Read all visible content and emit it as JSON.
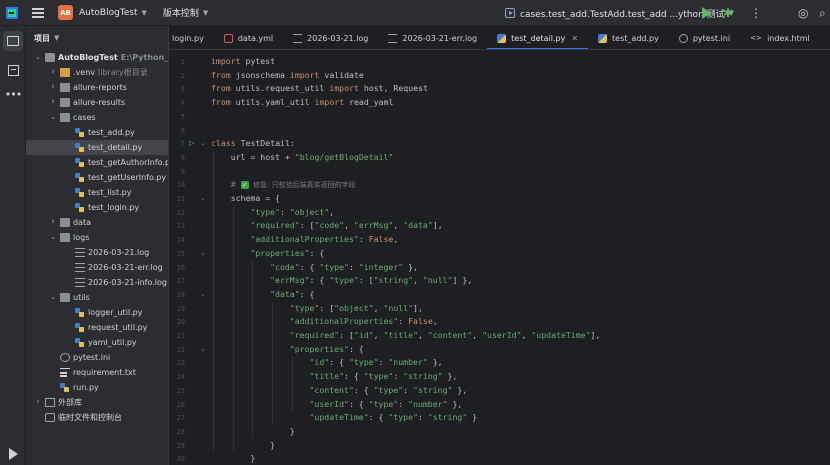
{
  "titlebar": {
    "project_badge": "AB",
    "project_name": "AutoBlogTest",
    "vcs_label": "版本控制",
    "run_config": "cases.test_add.TestAdd.test_add ...ython 测试"
  },
  "project_panel": {
    "title": "项目",
    "tree": [
      {
        "label": "AutoBlogTest",
        "sub": "E:\\Python_Auto",
        "indent": 0,
        "arrow": "down",
        "icon": "folder",
        "bold": true
      },
      {
        "label": ".venv",
        "sub": "library根目录",
        "indent": 1,
        "arrow": "right",
        "icon": "folder-excluded"
      },
      {
        "label": "allure-reports",
        "indent": 1,
        "arrow": "right",
        "icon": "folder"
      },
      {
        "label": "allure-results",
        "indent": 1,
        "arrow": "right",
        "icon": "folder"
      },
      {
        "label": "cases",
        "indent": 1,
        "arrow": "down",
        "icon": "folder"
      },
      {
        "label": "test_add.py",
        "indent": 2,
        "icon": "python"
      },
      {
        "label": "test_detail.py",
        "indent": 2,
        "icon": "python",
        "selected": true
      },
      {
        "label": "test_getAuthorInfo.py",
        "indent": 2,
        "icon": "python"
      },
      {
        "label": "test_getUserInfo.py",
        "indent": 2,
        "icon": "python"
      },
      {
        "label": "test_list.py",
        "indent": 2,
        "icon": "python"
      },
      {
        "label": "test_login.py",
        "indent": 2,
        "icon": "python"
      },
      {
        "label": "data",
        "indent": 1,
        "arrow": "right",
        "icon": "folder"
      },
      {
        "label": "logs",
        "indent": 1,
        "arrow": "down",
        "icon": "folder"
      },
      {
        "label": "2026-03-21.log",
        "indent": 2,
        "icon": "log"
      },
      {
        "label": "2026-03-21-err.log",
        "indent": 2,
        "icon": "log"
      },
      {
        "label": "2026-03-21-info.log",
        "indent": 2,
        "icon": "log"
      },
      {
        "label": "utils",
        "indent": 1,
        "arrow": "down",
        "icon": "folder"
      },
      {
        "label": "logger_util.py",
        "indent": 2,
        "icon": "python"
      },
      {
        "label": "request_util.py",
        "indent": 2,
        "icon": "python"
      },
      {
        "label": "yaml_util.py",
        "indent": 2,
        "icon": "python"
      },
      {
        "label": "pytest.ini",
        "indent": 1,
        "icon": "ini"
      },
      {
        "label": "requirement.txt",
        "indent": 1,
        "icon": "txt"
      },
      {
        "label": "run.py",
        "indent": 1,
        "icon": "python"
      },
      {
        "label": "外部库",
        "indent": 0,
        "arrow": "right",
        "icon": "library"
      },
      {
        "label": "临时文件和控制台",
        "indent": 0,
        "icon": "scratch"
      }
    ]
  },
  "tabs": [
    {
      "label": "login.py",
      "icon": "python"
    },
    {
      "label": "data.yml",
      "icon": "yaml"
    },
    {
      "label": "2026-03-21.log",
      "icon": "log"
    },
    {
      "label": "2026-03-21-err.log",
      "icon": "log"
    },
    {
      "label": "test_detail.py",
      "icon": "python",
      "active": true
    },
    {
      "label": "test_add.py",
      "icon": "python"
    },
    {
      "label": "pytest.ini",
      "icon": "ini"
    },
    {
      "label": "index.html",
      "icon": "html"
    }
  ],
  "editor": {
    "lines": [
      {
        "n": "1",
        "segs": [
          [
            "kw",
            "import"
          ],
          [
            "",
            "pytest"
          ]
        ]
      },
      {
        "n": "2",
        "segs": [
          [
            "kw",
            "from"
          ],
          [
            "",
            "jsonschema"
          ],
          [
            "kw",
            "import"
          ],
          [
            "",
            "validate"
          ]
        ]
      },
      {
        "n": "3",
        "segs": [
          [
            "kw",
            "from"
          ],
          [
            "",
            "utils.request_util"
          ],
          [
            "kw",
            "import"
          ],
          [
            "",
            "host, Request"
          ]
        ]
      },
      {
        "n": "4",
        "segs": [
          [
            "kw",
            "from"
          ],
          [
            "",
            "utils.yaml_util"
          ],
          [
            "kw",
            "import"
          ],
          [
            "",
            "read_yaml"
          ]
        ]
      },
      {
        "n": "5",
        "segs": []
      },
      {
        "n": "6",
        "segs": []
      },
      {
        "n": "7",
        "segs": [
          [
            "kw",
            "class"
          ],
          [
            "",
            "TestDetail:"
          ]
        ],
        "run": true,
        "fold": true
      },
      {
        "n": "8",
        "indent": 1,
        "segs": [
          [
            "",
            "url = host + "
          ],
          [
            "str",
            "\"blog/getBlogDetail\""
          ]
        ]
      },
      {
        "n": "9",
        "segs": []
      },
      {
        "n": "10",
        "indent": 1,
        "segs": [
          [
            "cmt",
            "# "
          ],
          [
            "check",
            "✓"
          ],
          [
            "cmtcn",
            "  修复: 只校验后端真实返回的字段"
          ]
        ]
      },
      {
        "n": "11",
        "indent": 1,
        "segs": [
          [
            "",
            "schema = {"
          ]
        ],
        "fold": true
      },
      {
        "n": "12",
        "indent": 2,
        "segs": [
          [
            "str",
            "\"type\""
          ],
          [
            "",
            ": "
          ],
          [
            "str",
            "\"object\""
          ],
          [
            "",
            ","
          ]
        ]
      },
      {
        "n": "13",
        "indent": 2,
        "segs": [
          [
            "str",
            "\"required\""
          ],
          [
            "",
            ": ["
          ],
          [
            "str",
            "\"code\""
          ],
          [
            "",
            ", "
          ],
          [
            "str",
            "\"errMsg\""
          ],
          [
            "",
            ", "
          ],
          [
            "str",
            "\"data\""
          ],
          [
            "",
            "],"
          ]
        ]
      },
      {
        "n": "14",
        "indent": 2,
        "segs": [
          [
            "str",
            "\"additionalProperties\""
          ],
          [
            "",
            ": "
          ],
          [
            "kw",
            "False"
          ],
          [
            "",
            ","
          ]
        ]
      },
      {
        "n": "15",
        "indent": 2,
        "segs": [
          [
            "str",
            "\"properties\""
          ],
          [
            "",
            ": {"
          ]
        ],
        "fold": true
      },
      {
        "n": "16",
        "indent": 3,
        "segs": [
          [
            "str",
            "\"code\""
          ],
          [
            "",
            ": { "
          ],
          [
            "str",
            "\"type\""
          ],
          [
            "",
            ": "
          ],
          [
            "str",
            "\"integer\""
          ],
          [
            "",
            " },"
          ]
        ]
      },
      {
        "n": "17",
        "indent": 3,
        "segs": [
          [
            "str",
            "\"errMsg\""
          ],
          [
            "",
            ": { "
          ],
          [
            "str",
            "\"type\""
          ],
          [
            "",
            ": ["
          ],
          [
            "str",
            "\"string\""
          ],
          [
            "",
            ", "
          ],
          [
            "str",
            "\"null\""
          ],
          [
            "",
            "] },"
          ]
        ]
      },
      {
        "n": "18",
        "indent": 3,
        "segs": [
          [
            "str",
            "\"data\""
          ],
          [
            "",
            ": {"
          ]
        ],
        "fold": true
      },
      {
        "n": "19",
        "indent": 4,
        "segs": [
          [
            "str",
            "\"type\""
          ],
          [
            "",
            ": ["
          ],
          [
            "str",
            "\"object\""
          ],
          [
            "",
            ", "
          ],
          [
            "str",
            "\"null\""
          ],
          [
            "",
            "],"
          ]
        ]
      },
      {
        "n": "20",
        "indent": 4,
        "segs": [
          [
            "str",
            "\"additionalProperties\""
          ],
          [
            "",
            ": "
          ],
          [
            "kw",
            "False"
          ],
          [
            "",
            ","
          ]
        ]
      },
      {
        "n": "21",
        "indent": 4,
        "segs": [
          [
            "str",
            "\"required\""
          ],
          [
            "",
            ": ["
          ],
          [
            "str",
            "\"id\""
          ],
          [
            "",
            ", "
          ],
          [
            "str",
            "\"title\""
          ],
          [
            "",
            ", "
          ],
          [
            "str",
            "\"content\""
          ],
          [
            "",
            ", "
          ],
          [
            "str",
            "\"userId\""
          ],
          [
            "",
            ", "
          ],
          [
            "str",
            "\"updateTime\""
          ],
          [
            "",
            "],"
          ]
        ]
      },
      {
        "n": "22",
        "indent": 4,
        "segs": [
          [
            "str",
            "\"properties\""
          ],
          [
            "",
            ": {"
          ]
        ],
        "fold": true
      },
      {
        "n": "23",
        "indent": 5,
        "segs": [
          [
            "str",
            "\"id\""
          ],
          [
            "",
            ": { "
          ],
          [
            "str",
            "\"type\""
          ],
          [
            "",
            ": "
          ],
          [
            "str",
            "\"number\""
          ],
          [
            "",
            " },"
          ]
        ]
      },
      {
        "n": "24",
        "indent": 5,
        "segs": [
          [
            "str",
            "\"title\""
          ],
          [
            "",
            ": { "
          ],
          [
            "str",
            "\"type\""
          ],
          [
            "",
            ": "
          ],
          [
            "str",
            "\"string\""
          ],
          [
            "",
            " },"
          ]
        ]
      },
      {
        "n": "25",
        "indent": 5,
        "segs": [
          [
            "str",
            "\"content\""
          ],
          [
            "",
            ": { "
          ],
          [
            "str",
            "\"type\""
          ],
          [
            "",
            ": "
          ],
          [
            "str",
            "\"string\""
          ],
          [
            "",
            " },"
          ]
        ]
      },
      {
        "n": "26",
        "indent": 5,
        "segs": [
          [
            "str",
            "\"userId\""
          ],
          [
            "",
            ": { "
          ],
          [
            "str",
            "\"type\""
          ],
          [
            "",
            ": "
          ],
          [
            "str",
            "\"number\""
          ],
          [
            "",
            " },"
          ]
        ]
      },
      {
        "n": "27",
        "indent": 5,
        "segs": [
          [
            "str",
            "\"updateTime\""
          ],
          [
            "",
            ": { "
          ],
          [
            "str",
            "\"type\""
          ],
          [
            "",
            ": "
          ],
          [
            "str",
            "\"string\""
          ],
          [
            "",
            " }"
          ]
        ]
      },
      {
        "n": "28",
        "indent": 4,
        "segs": [
          [
            "",
            "}"
          ]
        ]
      },
      {
        "n": "29",
        "indent": 3,
        "segs": [
          [
            "",
            "}"
          ]
        ]
      },
      {
        "n": "30",
        "indent": 2,
        "segs": [
          [
            "",
            "}"
          ]
        ]
      }
    ]
  }
}
